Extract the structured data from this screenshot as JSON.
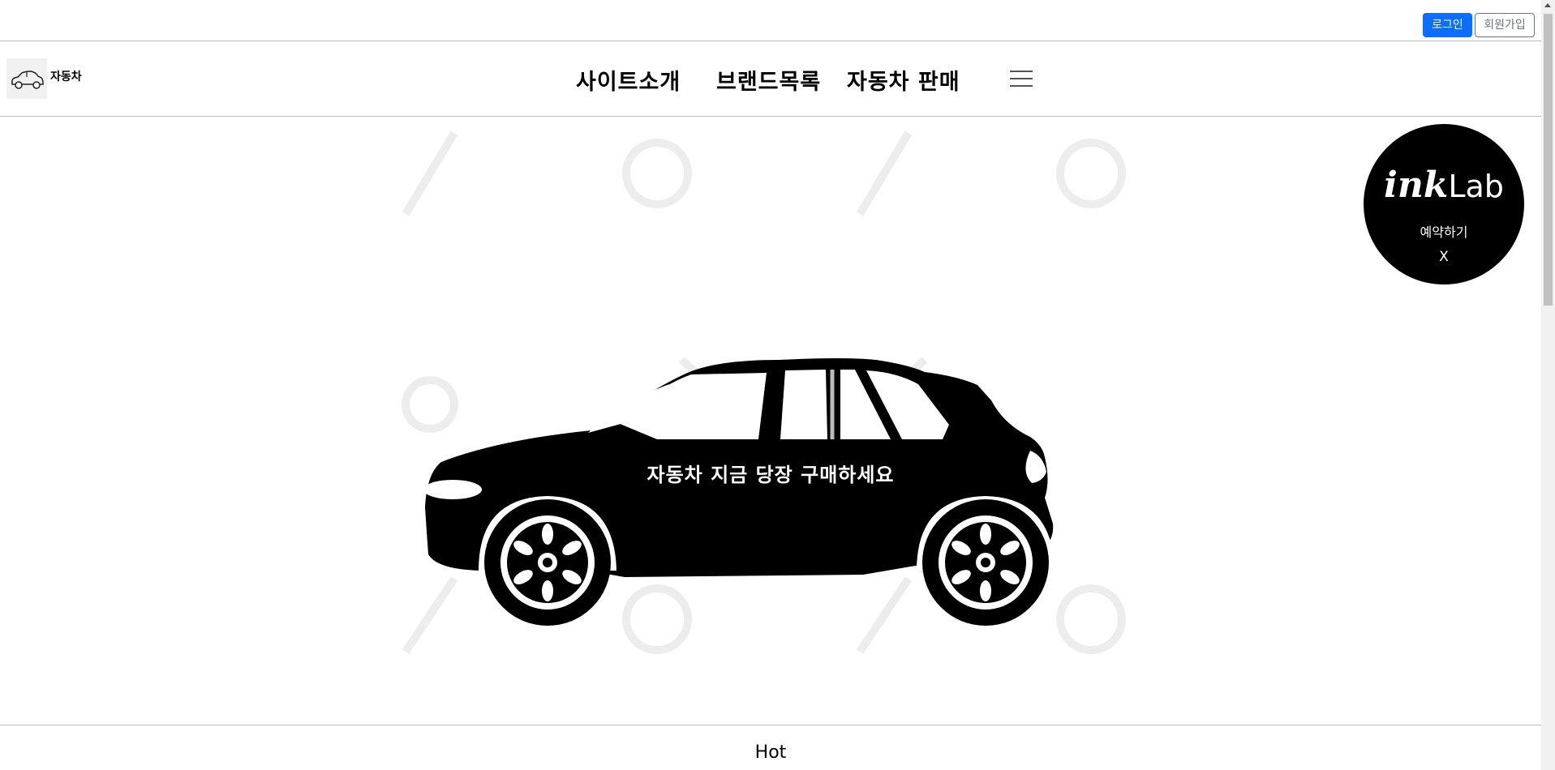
{
  "auth": {
    "login_label": "로그인",
    "signup_label": "회원가입"
  },
  "nav": {
    "logo_text": "자동차",
    "links": [
      "사이트소개",
      "브랜드목록",
      "자동차 판매"
    ],
    "menu_icon": "hamburger-icon"
  },
  "hero": {
    "headline": "자동차 지금 당장 구매하세요",
    "image": "black-suv-silhouette"
  },
  "ad": {
    "brand_ink": "ink",
    "brand_lab": "Lab",
    "reserve_label": "예약하기",
    "close_label": "X"
  },
  "section": {
    "title": "Hot"
  },
  "colors": {
    "primary": "#0d6efd",
    "secondary": "#6c757d",
    "dark": "#000000"
  }
}
